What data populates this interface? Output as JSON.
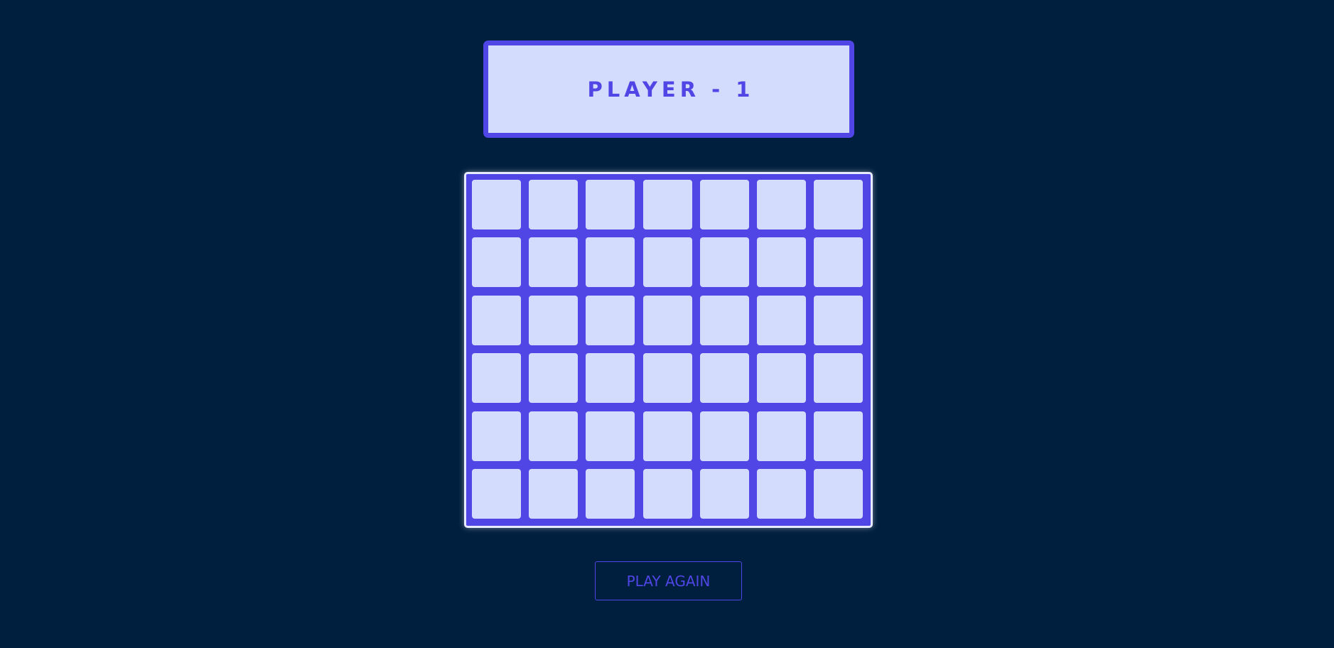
{
  "header": {
    "player_label": "PLAYER - 1"
  },
  "board": {
    "rows": 6,
    "columns": 7,
    "cells": [
      [
        "",
        "",
        "",
        "",
        "",
        "",
        ""
      ],
      [
        "",
        "",
        "",
        "",
        "",
        "",
        ""
      ],
      [
        "",
        "",
        "",
        "",
        "",
        "",
        ""
      ],
      [
        "",
        "",
        "",
        "",
        "",
        "",
        ""
      ],
      [
        "",
        "",
        "",
        "",
        "",
        "",
        ""
      ],
      [
        "",
        "",
        "",
        "",
        "",
        "",
        ""
      ]
    ]
  },
  "controls": {
    "play_again_label": "PLAY AGAIN"
  },
  "colors": {
    "background": "#001f3f",
    "accent": "#4f46e5",
    "cell_empty": "#d4dcfd"
  }
}
